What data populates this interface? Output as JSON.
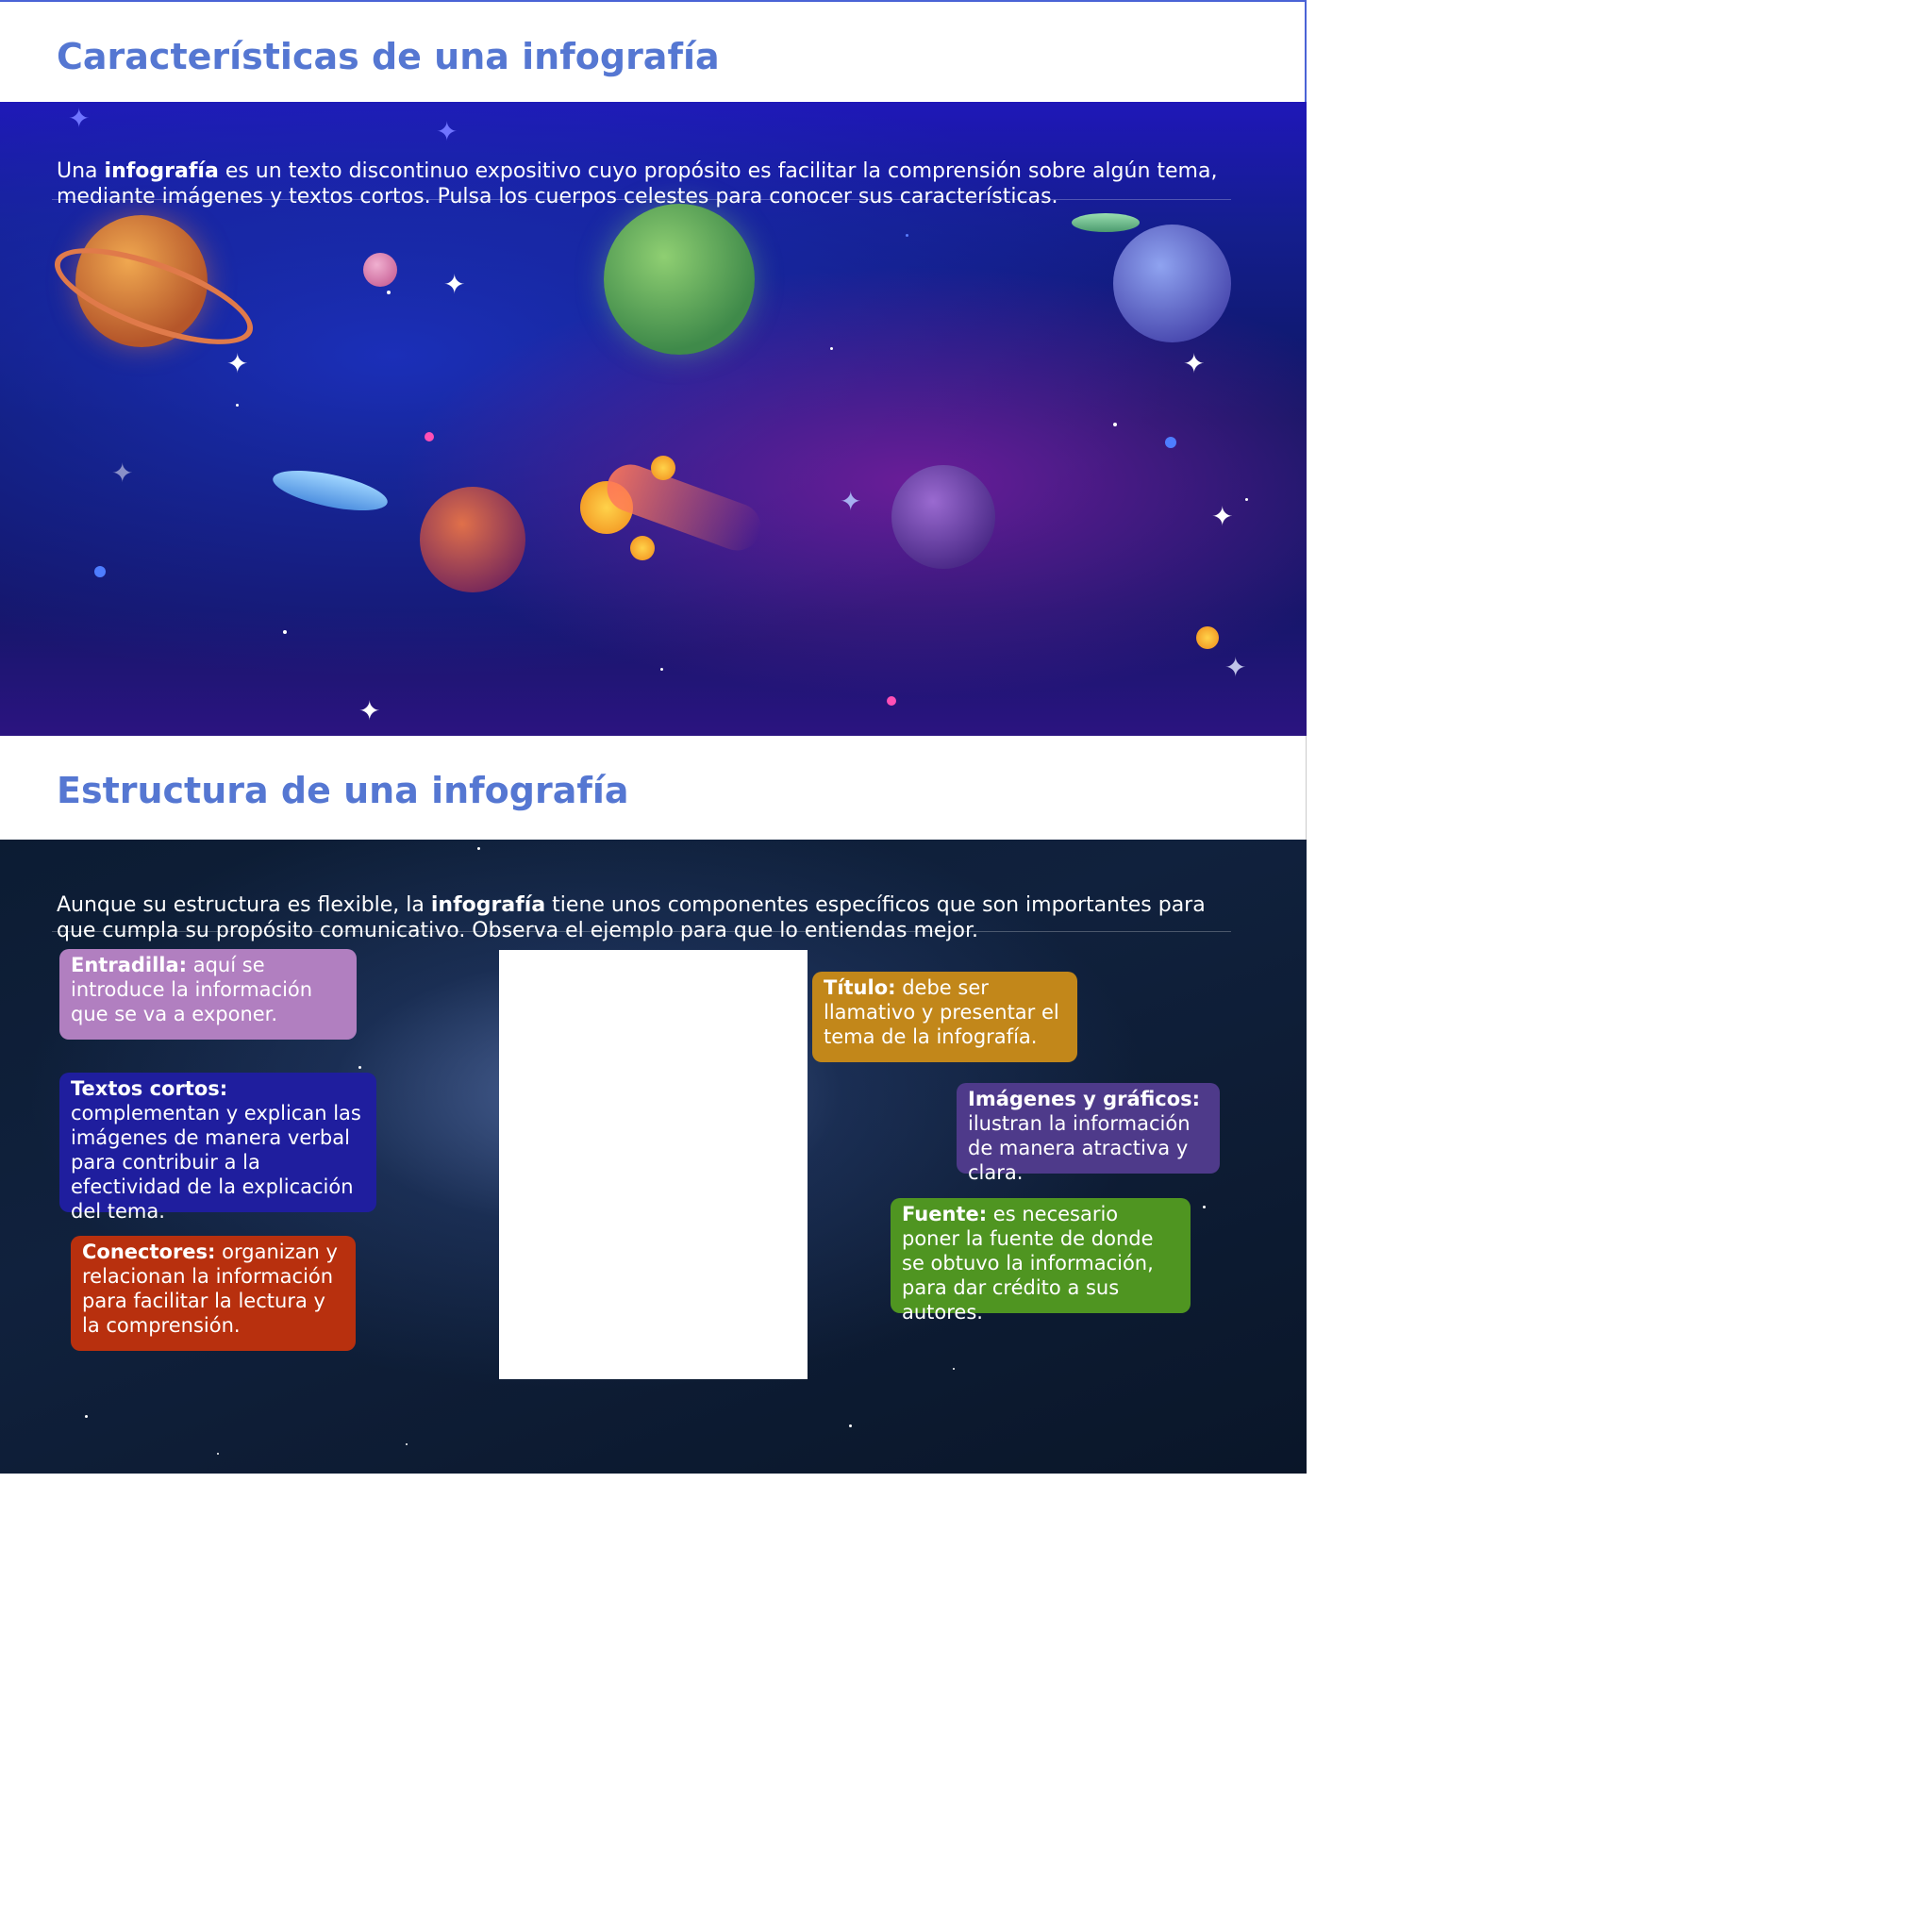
{
  "section1": {
    "title": "Características de una infografía",
    "intro_before": "Una ",
    "intro_bold": "infografía",
    "intro_after": " es un texto discontinuo expositivo cuyo propósito es facilitar la comprensión sobre algún tema, mediante imágenes y textos cortos. Pulsa los cuerpos celestes para conocer sus características."
  },
  "section2": {
    "title": "Estructura de una infografía",
    "intro_before": "Aunque su estructura es flexible, la ",
    "intro_bold": "infografía",
    "intro_after": " tiene unos componentes específicos que son importantes para que cumpla su propósito comunicativo. Observa el ejemplo para que lo entiendas mejor.",
    "cards": {
      "entradilla": {
        "term": "Entradilla:",
        "text": " aquí se introduce la información que se va a exponer.",
        "color": "#b17fc0"
      },
      "textos": {
        "term": "Textos cortos:",
        "text": " complementan y explican las imágenes de manera verbal para contribuir a la efectividad de la explicación del tema.",
        "color": "#1f1e9e"
      },
      "conectores": {
        "term": "Conectores:",
        "text": " organizan y relacionan la información para facilitar la lectura y la comprensión.",
        "color": "#b8300e"
      },
      "titulo": {
        "term": "Título:",
        "text": " debe ser llamativo y presentar el tema de la infografía.",
        "color": "#c2871a"
      },
      "imagenes": {
        "term": "Imágenes y gráficos:",
        "text": " ilustran la información de manera atractiva y clara.",
        "color": "#4e3a8a"
      },
      "fuente": {
        "term": "Fuente:",
        "text": " es necesario poner la fuente de donde se obtuvo la información, para dar crédito a  sus autores.",
        "color": "#4f9521"
      }
    }
  }
}
